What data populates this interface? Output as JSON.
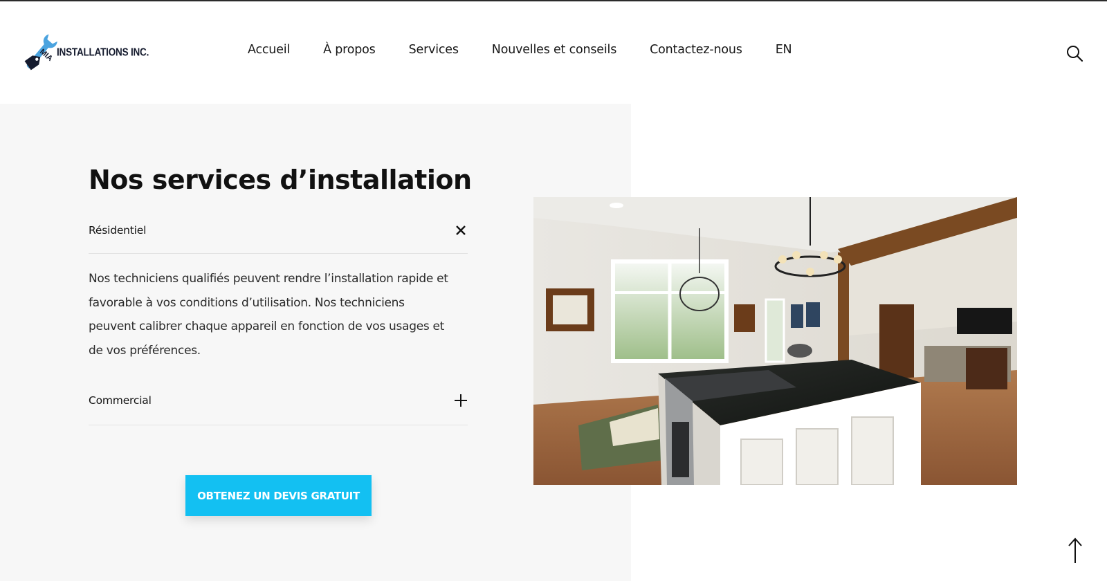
{
  "header": {
    "logo_text": "INSTALLATIONS INC.",
    "logo_mark": "MIA",
    "nav": [
      {
        "label": "Accueil"
      },
      {
        "label": "À propos"
      },
      {
        "label": "Services"
      },
      {
        "label": "Nouvelles et conseils"
      },
      {
        "label": "Contactez-nous"
      },
      {
        "label": "EN"
      }
    ],
    "search_icon": "search-icon"
  },
  "section": {
    "title": "Nos services d’installation",
    "accordion": [
      {
        "label": "Résidentiel",
        "expanded": true,
        "toggle_icon": "close-icon",
        "body": "Nos techniciens qualifiés peuvent rendre l’installation rapide et favorable à vos conditions d’utilisation. Nos techniciens peuvent calibrer chaque appareil en fonction de vos usages et de vos préférences."
      },
      {
        "label": "Commercial",
        "expanded": false,
        "toggle_icon": "plus-icon"
      }
    ],
    "cta_label": "OBTENEZ UN DEVIS GRATUIT",
    "photo_alt": "kitchen-photo"
  },
  "colors": {
    "accent": "#13c0f2",
    "panel_bg": "#f7f7f7",
    "logo_blue": "#4aa3df",
    "logo_navy": "#151b2e"
  },
  "footer": {
    "back_to_top_icon": "arrow-up-icon"
  }
}
